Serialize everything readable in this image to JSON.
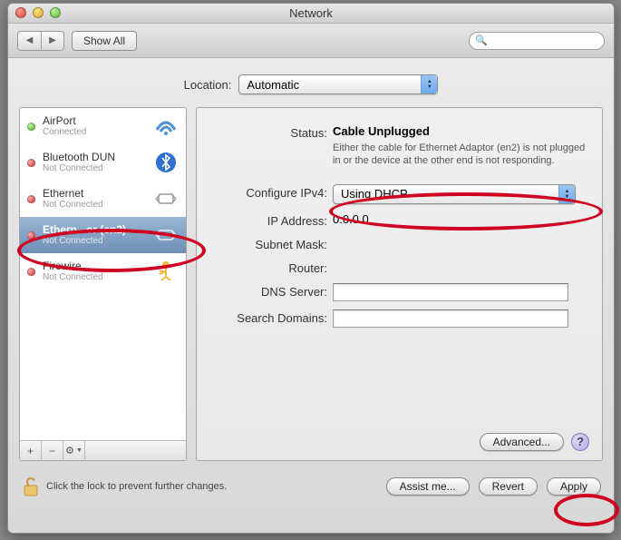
{
  "window": {
    "title": "Network"
  },
  "toolbar": {
    "show_all": "Show All",
    "search_placeholder": ""
  },
  "location": {
    "label": "Location:",
    "value": "Automatic"
  },
  "services": [
    {
      "name": "AirPort",
      "status": "Connected",
      "dot": "green",
      "icon": "airport"
    },
    {
      "name": "Bluetooth DUN",
      "status": "Not Connected",
      "dot": "red",
      "icon": "bluetooth"
    },
    {
      "name": "Ethernet",
      "status": "Not Connected",
      "dot": "red",
      "icon": "ethernet"
    },
    {
      "name": "Ethern...or (en2)",
      "status": "Not Connected",
      "dot": "red",
      "icon": "ethernet",
      "selected": true
    },
    {
      "name": "Firewire",
      "status": "Not Connected",
      "dot": "red",
      "icon": "firewire"
    }
  ],
  "sidebar_footer": {
    "add": "+",
    "remove": "−",
    "gear": "⚙"
  },
  "detail": {
    "status_label": "Status:",
    "status_value": "Cable Unplugged",
    "status_desc": "Either the cable for Ethernet Adaptor (en2) is not plugged in or the device at the other end is not responding.",
    "config_label": "Configure IPv4:",
    "config_value": "Using DHCP",
    "ip_label": "IP Address:",
    "ip_value": "0.0.0.0",
    "subnet_label": "Subnet Mask:",
    "subnet_value": "",
    "router_label": "Router:",
    "router_value": "",
    "dns_label": "DNS Server:",
    "dns_value": "",
    "search_label": "Search Domains:",
    "search_value": "",
    "advanced": "Advanced..."
  },
  "footer": {
    "lock_text": "Click the lock to prevent further changes.",
    "assist": "Assist me...",
    "revert": "Revert",
    "apply": "Apply"
  }
}
